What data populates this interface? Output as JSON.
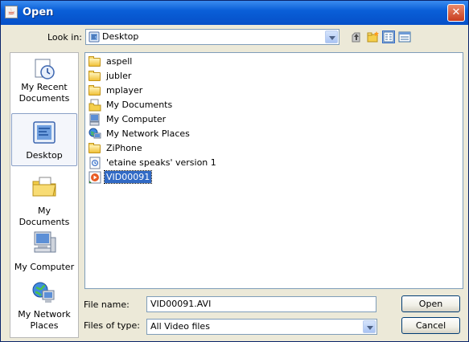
{
  "window": {
    "title": "Open",
    "title_icon": "java-coffee-icon",
    "close_label": "✕"
  },
  "look_in": {
    "label": "Look in:",
    "value": "Desktop"
  },
  "toolbar": {
    "icons": [
      "up-one-level-icon",
      "create-new-folder-icon",
      "list-view-icon",
      "details-view-icon"
    ]
  },
  "places": [
    {
      "label_line1": "My Recent",
      "label_line2": "Documents",
      "icon": "recent-documents-icon"
    },
    {
      "label_line1": "Desktop",
      "label_line2": "",
      "icon": "desktop-icon"
    },
    {
      "label_line1": "My Documents",
      "label_line2": "",
      "icon": "my-documents-icon"
    },
    {
      "label_line1": "My Computer",
      "label_line2": "",
      "icon": "my-computer-icon"
    },
    {
      "label_line1": "My Network",
      "label_line2": "Places",
      "icon": "network-places-icon"
    }
  ],
  "files": [
    {
      "name": "aspell",
      "icon": "folder-icon"
    },
    {
      "name": "jubler",
      "icon": "folder-icon"
    },
    {
      "name": "mplayer",
      "icon": "folder-icon"
    },
    {
      "name": "My Documents",
      "icon": "my-documents-folder-icon"
    },
    {
      "name": "My Computer",
      "icon": "computer-icon"
    },
    {
      "name": "My Network Places",
      "icon": "network-icon"
    },
    {
      "name": "ZiPhone",
      "icon": "folder-icon"
    },
    {
      "name": "'etaine speaks' version 1",
      "icon": "shortcut-icon"
    },
    {
      "name": "VID00091",
      "icon": "video-file-icon",
      "selected": true
    }
  ],
  "file_name": {
    "label": "File name:",
    "value": "VID00091.AVI"
  },
  "file_type": {
    "label": "Files of type:",
    "value": "All Video files"
  },
  "buttons": {
    "open": "Open",
    "cancel": "Cancel"
  }
}
